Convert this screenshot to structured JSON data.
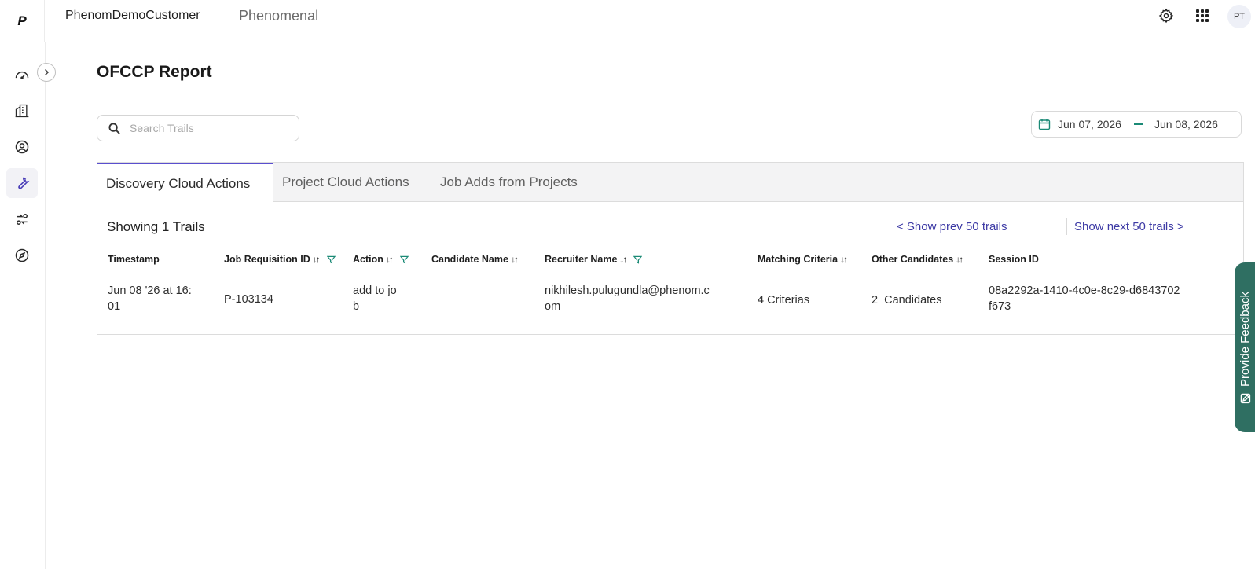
{
  "topbar": {
    "logo_letter": "P",
    "org_name": "PhenomDemoCustomer",
    "product_name": "Phenomenal",
    "avatar_initials": "PT"
  },
  "sidebar": {
    "items": [
      {
        "name": "dashboard",
        "icon": "speedometer-icon"
      },
      {
        "name": "organization",
        "icon": "buildings-icon"
      },
      {
        "name": "profile",
        "icon": "user-circle-icon"
      },
      {
        "name": "tools",
        "icon": "wrench-icon",
        "active": true
      },
      {
        "name": "sync",
        "icon": "transfer-icon"
      },
      {
        "name": "explore",
        "icon": "compass-icon"
      }
    ]
  },
  "page": {
    "title": "OFCCP Report"
  },
  "search": {
    "placeholder": "Search Trails",
    "value": ""
  },
  "date_range": {
    "start": "Jun 07, 2026",
    "end": "Jun 08, 2026"
  },
  "tabs": [
    {
      "label": "Discovery Cloud Actions",
      "active": true
    },
    {
      "label": "Project Cloud Actions",
      "active": false
    },
    {
      "label": "Job Adds from Projects",
      "active": false
    }
  ],
  "table": {
    "showing_text": "Showing 1 Trails",
    "prev_label": "< Show prev 50 trails",
    "next_label": "Show next 50 trails >",
    "sort_glyph": "↓↑",
    "headers": [
      "Timestamp",
      "Job Requisition ID",
      "Action",
      "Candidate Name",
      "Recruiter Name",
      "Matching Criteria",
      "Other Candidates",
      "Session ID"
    ],
    "rows": [
      {
        "timestamp": [
          "Jun 08 '26 at 16:",
          "01"
        ],
        "job_requisition_id": "P-103134",
        "action": [
          "add to jo",
          "b"
        ],
        "candidate_name": "",
        "recruiter_name": [
          "nikhilesh.pulugundla@phenom.c",
          "om"
        ],
        "matching_criteria": "4 Criterias",
        "other_candidates": "2  Candidates",
        "session_id": [
          "08a2292a-1410-4c0e-8c29-d6843702",
          "f673"
        ]
      }
    ]
  },
  "feedback": {
    "label": "Provide Feedback"
  },
  "colors": {
    "accent": "#5a4fcf",
    "link": "#3d3aa5",
    "teal": "#1b8a76",
    "feedback_bg": "#2f6f62"
  }
}
